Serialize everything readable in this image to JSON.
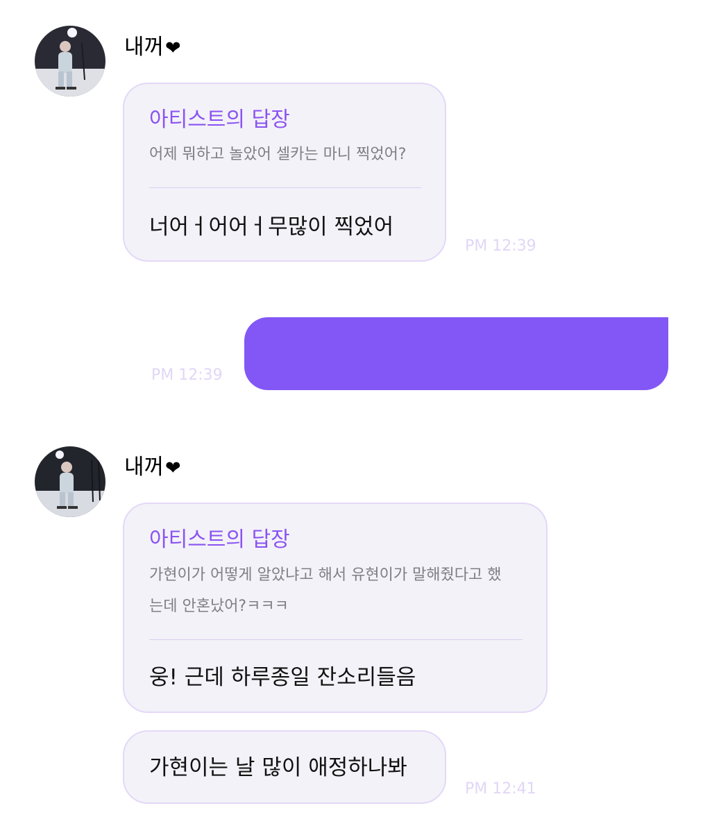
{
  "theme": {
    "accent": "#8257f5",
    "reply_title_color": "#8a52f2",
    "bubble_bg": "#f3f2f8",
    "bubble_border": "#e3d8f8",
    "timestamp_color": "#e2d6f6"
  },
  "messages": [
    {
      "sender": {
        "name": "내꺼",
        "heart": "❤",
        "avatar_icon": "profile-photo-icon"
      },
      "reply": {
        "title": "아티스트의 답장",
        "quote": "어제 뭐하고 놀았어 셀카는 마니 찍었어?",
        "body": "너어ㅓ어어ㅓ무많이 찍었어"
      },
      "time": "PM 12:39"
    },
    {
      "outgoing": true,
      "time": "PM 12:39"
    },
    {
      "sender": {
        "name": "내꺼",
        "heart": "❤",
        "avatar_icon": "profile-photo-icon"
      },
      "reply": {
        "title": "아티스트의 답장",
        "quote_line1": "가현이가 어떻게 알았냐고 해서 유현이가 말해줬다고 했",
        "quote_line2": "는데 안혼났어?ㅋㅋㅋ",
        "body": "웅! 근데 하루종일 잔소리들음"
      },
      "followup": "가현이는 날 많이 애정하나봐",
      "time": "PM 12:41"
    }
  ]
}
